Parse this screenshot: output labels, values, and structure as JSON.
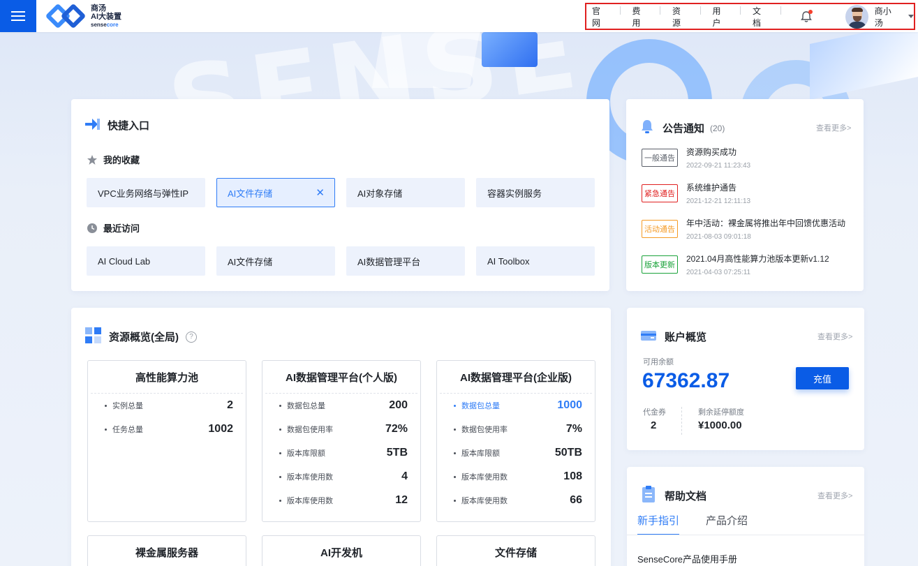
{
  "header": {
    "logo": {
      "line1": "商汤",
      "line2": "AI大装置",
      "line3_a": "sense",
      "line3_b": "core"
    },
    "nav": [
      "官网",
      "费用",
      "资源",
      "用户",
      "文档"
    ],
    "user": {
      "name": "商小汤"
    }
  },
  "background": {
    "letters": "SENSE"
  },
  "quick": {
    "title": "快捷入口",
    "favorites_title": "我的收藏",
    "favorites": [
      {
        "label": "VPC业务网络与弹性IP",
        "active": false
      },
      {
        "label": "AI文件存储",
        "active": true,
        "close": "✕"
      },
      {
        "label": "AI对象存储",
        "active": false
      },
      {
        "label": "容器实例服务",
        "active": false
      }
    ],
    "recent_title": "最近访问",
    "recent": [
      "AI Cloud Lab",
      "AI文件存储",
      "AI数据管理平台",
      "AI Toolbox"
    ]
  },
  "notice": {
    "title": "公告通知",
    "count": "(20)",
    "more": "查看更多>",
    "items": [
      {
        "tag": "一般通告",
        "tag_color": "#5a5f69",
        "title": "资源购买成功",
        "time": "2022-09-21  11:23:43"
      },
      {
        "tag": "紧急通告",
        "tag_color": "#e02020",
        "title": "系统维护通告",
        "time": "2021-12-21  12:11:13"
      },
      {
        "tag": "活动通告",
        "tag_color": "#f59a23",
        "title": "年中活动：裸金属将推出年中回馈优惠活动",
        "time": "2021-08-03  09:01:18"
      },
      {
        "tag": "版本更新",
        "tag_color": "#1aa33a",
        "title": "2021.04月高性能算力池版本更新v1.12",
        "time": "2021-04-03  07:25:11"
      }
    ]
  },
  "resource": {
    "title": "资源概览(全局)",
    "help_icon": "?",
    "boxes": [
      {
        "title": "高性能算力池",
        "rows": [
          {
            "k": "实例总量",
            "v": "2"
          },
          {
            "k": "任务总量",
            "v": "1002"
          }
        ]
      },
      {
        "title": "AI数据管理平台(个人版)",
        "rows": [
          {
            "k": "数据包总量",
            "v": "200"
          },
          {
            "k": "数据包使用率",
            "v": "72%"
          },
          {
            "k": "版本库限额",
            "v": "5TB"
          },
          {
            "k": "版本库使用数",
            "v": "4"
          },
          {
            "k": "版本库使用数",
            "v": "12"
          }
        ]
      },
      {
        "title": "AI数据管理平台(企业版)",
        "rows": [
          {
            "k": "数据包总量",
            "v": "1000",
            "hl": true
          },
          {
            "k": "数据包使用率",
            "v": "7%"
          },
          {
            "k": "版本库限额",
            "v": "50TB"
          },
          {
            "k": "版本库使用数",
            "v": "108"
          },
          {
            "k": "版本库使用数",
            "v": "66"
          }
        ]
      }
    ],
    "second_row": [
      "裸金属服务器",
      "AI开发机",
      "文件存储"
    ]
  },
  "account": {
    "title": "账户概览",
    "more": "查看更多>",
    "balance_label": "可用余额",
    "balance": "67362.87",
    "recharge": "充值",
    "voucher_label": "代金券",
    "voucher": "2",
    "credit_label": "剩余延停额度",
    "credit": "¥1000.00"
  },
  "help": {
    "title": "帮助文档",
    "more": "查看更多>",
    "tabs": [
      "新手指引",
      "产品介绍"
    ],
    "doc": "SenseCore产品使用手册"
  },
  "colors": {
    "primary": "#0a5ce6",
    "accent": "#2f7cf6"
  }
}
